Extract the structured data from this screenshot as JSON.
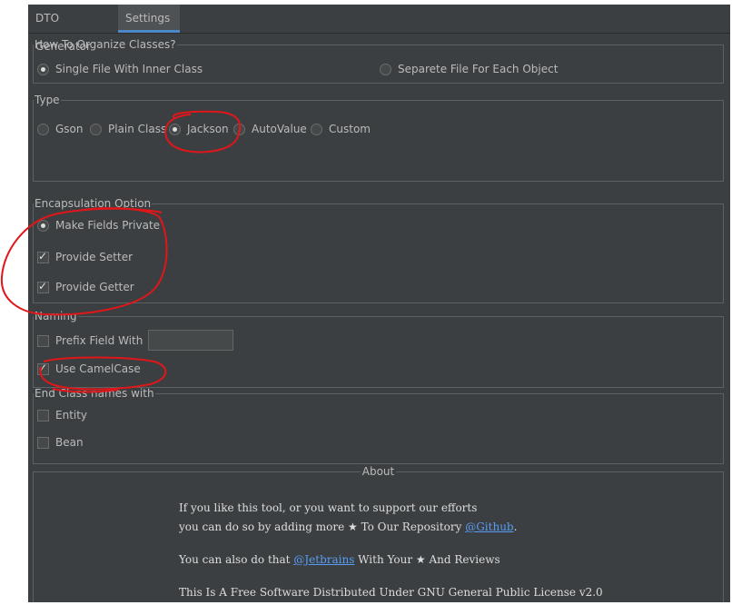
{
  "tabs": [
    {
      "label": "DTO Generator",
      "active": false
    },
    {
      "label": "Settings",
      "active": true
    }
  ],
  "organize": {
    "legend": "How To Organize Classes?",
    "options": [
      {
        "label": "Single File With Inner Class",
        "selected": true
      },
      {
        "label": "Separete File For Each Object",
        "selected": false
      }
    ]
  },
  "type": {
    "legend": "Type",
    "options": [
      {
        "label": "Gson",
        "selected": false
      },
      {
        "label": "Plain Class",
        "selected": false
      },
      {
        "label": "Jackson",
        "selected": true
      },
      {
        "label": "AutoValue",
        "selected": false
      },
      {
        "label": "Custom",
        "selected": false
      }
    ]
  },
  "encapsulation": {
    "legend": "Encapsulation Option",
    "options": [
      {
        "label": "Make Fields Private",
        "kind": "radio",
        "checked": true
      },
      {
        "label": "Provide Setter",
        "kind": "checkbox",
        "checked": true
      },
      {
        "label": "Provide Getter",
        "kind": "checkbox",
        "checked": true
      }
    ]
  },
  "naming": {
    "legend": "Naming",
    "prefix_label": "Prefix Field With",
    "prefix_checked": false,
    "prefix_value": "",
    "camel_label": "Use CamelCase",
    "camel_checked": true
  },
  "end_class": {
    "legend": "End Class names with",
    "options": [
      {
        "label": "Entity",
        "checked": false
      },
      {
        "label": "Bean",
        "checked": false
      }
    ]
  },
  "about": {
    "legend": "About",
    "line1": "If you like this tool, or you want to support our efforts",
    "line2_pre": "you can do so by adding more ★ To Our Repository ",
    "line2_link": "@Github",
    "line2_post": ".",
    "line3_pre": "You can also do that ",
    "line3_link": "@Jetbrains",
    "line3_post": " With Your ★ And Reviews",
    "line4": "This Is A Free Software Distributed Under GNU General Public License v2.0"
  },
  "colors": {
    "background": "#3c3f41",
    "accent": "#4a88c7",
    "link": "#589df6",
    "annotation": "#e0161a"
  }
}
